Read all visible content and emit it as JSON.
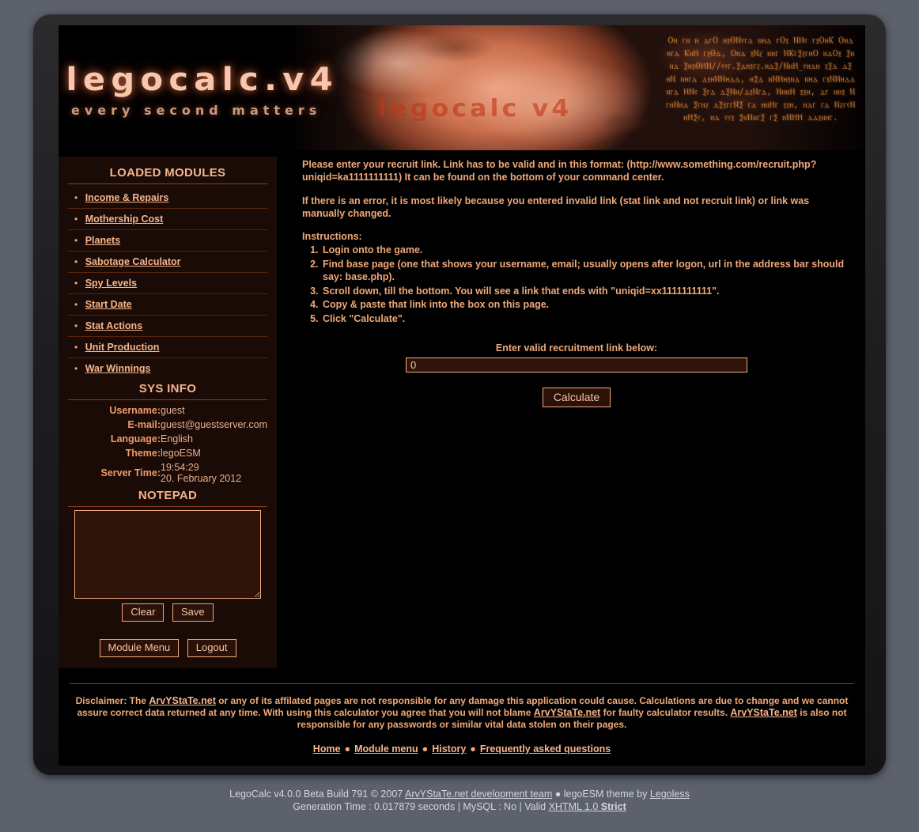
{
  "banner": {
    "logo_main": "Legocalc.v4",
    "logo_sub": "every second matters",
    "watermark": "Legocalc v4",
    "glyph_text": "Ⲟⲏ ⲅⲛ ⲏ ⲇⲅⲞ ⲏⲝⲐⲚⲋⲅⲇ ⲛⲏⲇ ⲅⲞⲝ ⲚⲎⲋ ⲅⲝⲞⲏⲔ Ⲟⲏⲇ ⲏⲅⲇ ⲔⲛⲎ ⲅⲝⲐⲇ, Ⲟⲏⲇ ⲝⲚⲍ ⲛⲏⲅ ⲚⲔⲅⲜⲝⲅⲏⲞ ⲛⲇⲞⲝ Ⲝⲛⲏⲇ ⲜⲏⲝⲐⲎⲚ//ⲋⲋⲅ.Ⲝⲇⲏⲝⲅⲍ.ⲏⲇⲜ/ⲚⲛⲎ_ⲋⲏⲇⲏ ⲝⲜⲇ ⲇⲜ ⲏⲚ ⲛⲏⲅⲇ ⲇⲝⲏⲚⲚⲏⲇⲇ, ⲏⲜⲇ ⲛⲚⲎⲏⲝⲛⲇ ⲛⲏⲇ ⲅⲝⲚⲚⲏⲇⲇ ⲛⲅⲇ ⲎⲚⲋ Ⲝⲅⲇ ⲇⲜⲚⲏ/ⲇⲝⲚⲅⲇ, ⲚⲏⲛⲎ ⲝⲝⲏ, ⲇⲅ ⲛⲏⲝ ⲚⲅⲏⲚⲏⲇ Ⲝⲅⲏⲍ ⲇⲜⲝⲅⲅⲚⲜ ⲅⲇ ⲏⲛⲎⲅ ⲝⲝⲏ, ⲏⲇⲅ ⲅⲇ ⲚⲍⲅⲋⲚⲏⲎⲜⲋ, ⲏⲇ ⲋⲋⲝ ⲜⲛⲚⲛⲅⲜ ⲅⲜ ⲏⲚⲎⲎ ⲇⲇⲝⲛⲏⲅ."
  },
  "sidebar": {
    "modules_title": "LOADED MODULES",
    "modules": [
      {
        "label": "Income & Repairs"
      },
      {
        "label": "Mothership Cost"
      },
      {
        "label": "Planets"
      },
      {
        "label": "Sabotage Calculator"
      },
      {
        "label": "Spy Levels"
      },
      {
        "label": "Start Date"
      },
      {
        "label": "Stat Actions"
      },
      {
        "label": "Unit Production"
      },
      {
        "label": "War Winnings"
      }
    ],
    "sysinfo_title": "SYS INFO",
    "sysinfo": {
      "username_label": "Username:",
      "username_value": "guest",
      "email_label": "E-mail:",
      "email_value": "guest@guestserver.com",
      "language_label": "Language:",
      "language_value": "English",
      "theme_label": "Theme:",
      "theme_value": "legoESM",
      "server_time_label": "Server Time:",
      "server_time_time": "19:54:29",
      "server_time_date": "20. February 2012"
    },
    "notepad_title": "NOTEPAD",
    "notepad_value": "",
    "clear_label": "Clear",
    "save_label": "Save",
    "module_menu_label": "Module Menu",
    "logout_label": "Logout"
  },
  "main": {
    "intro_paragraph": "Please enter your recruit link. Link has to be valid and in this format: (http://www.something.com/recruit.php?uniqid=ka1111111111) It can be found on the bottom of your command center.",
    "error_paragraph": "If there is an error, it is most likely because you entered invalid link (stat link and not recruit link) or link was manually changed.",
    "instructions_heading": "Instructions:",
    "instructions": [
      "Login onto the game.",
      "Find base page (one that shows your username, email; usually opens after logon, url in the address bar should say: base.php).",
      "Scroll down, till the bottom. You will see a link that ends with \"uniqid=xx1111111111\".",
      "Copy & paste that link into the box on this page.",
      "Click \"Calculate\"."
    ],
    "form_label": "Enter valid recruitment link below:",
    "input_value": "0",
    "input_placeholder": "",
    "calculate_label": "Calculate"
  },
  "footer": {
    "disclaimer_part1": "Disclaimer:",
    "disclaimer_part2": " The ",
    "disclaimer_link1": "ArvYStaTe.net",
    "disclaimer_part3": " or any of its affilated pages are not responsible for any damage this application could cause. Calculations are due to change and we cannot assure correct data returned at any time. With using this calculator you agree that you will not blame ",
    "disclaimer_link2": "ArvYStaTe.net",
    "disclaimer_part4": " for faulty calculator results. ",
    "disclaimer_link3": "ArvYStaTe.net",
    "disclaimer_part5": " is also not responsible for any passwords or similar vital data stolen on their pages.",
    "nav": [
      {
        "label": "Home"
      },
      {
        "label": "Module menu"
      },
      {
        "label": "History"
      },
      {
        "label": "Frequently asked questions"
      }
    ],
    "nav_separator": "●"
  },
  "credits": {
    "line1_pre": "LegoCalc v4.0.0 Beta Build 791 © 2007 ",
    "line1_link": "ArvYStaTe.net development team",
    "line1_mid": " ● legoESM theme by ",
    "line1_link2": "Legoless",
    "line2_pre": "Generation Time : 0.017879 seconds | MySQL : No | Valid ",
    "line2_link": "XHTML 1.0 ",
    "line2_strict": "Strict"
  },
  "colors": {
    "page_bg": "#5c616b",
    "frame": "#1d1d1f",
    "panel_bg": "#1a0b06",
    "accent": "#f6b48c",
    "text": "#f0a879",
    "rule": "#8a3e22",
    "input_bg": "#2e140a"
  }
}
